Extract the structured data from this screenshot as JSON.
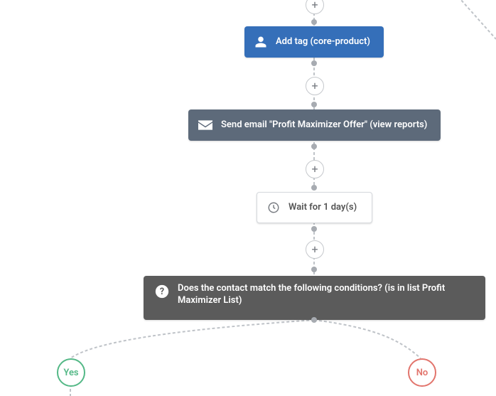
{
  "nodes": {
    "add_tag": {
      "label": "Add tag (core-product)"
    },
    "send_email": {
      "label": "Send email \"Profit Maximizer Offer\" (view reports)"
    },
    "wait": {
      "label": "Wait for 1 day(s)"
    },
    "condition": {
      "label": "Does the contact match the following conditions? (is in list Profit Maximizer List)"
    }
  },
  "controls": {
    "add_glyph": "+"
  },
  "branches": {
    "yes": "Yes",
    "no": "No"
  }
}
